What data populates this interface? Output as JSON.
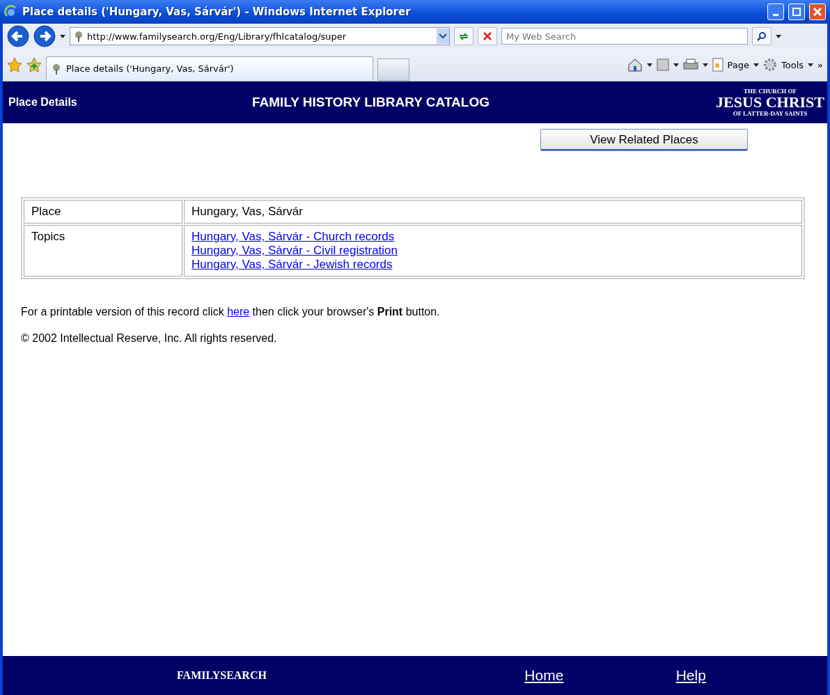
{
  "window": {
    "title": "Place details ('Hungary, Vas, Sárvár') - Windows Internet Explorer"
  },
  "address_bar": {
    "url": "http://www.familysearch.org/Eng/Library/fhlcatalog/super"
  },
  "search": {
    "placeholder": "My Web Search"
  },
  "tabs": [
    {
      "label": "Place details ('Hungary, Vas, Sárvár')",
      "selected": true
    }
  ],
  "command_bar": [
    {
      "label": "Page"
    },
    {
      "label": "Tools"
    }
  ],
  "overflow": "»",
  "banner": {
    "left": "Place Details",
    "center": "FAMILY HISTORY LIBRARY CATALOG",
    "logo_top": "THE CHURCH OF",
    "logo_main": "JESUS CHRIST",
    "logo_bottom": "OF LATTER-DAY SAINTS"
  },
  "related_button": "View Related Places",
  "details": [
    {
      "label": "Place",
      "kind": "text",
      "values": [
        "Hungary, Vas, Sárvár"
      ]
    },
    {
      "label": "Topics",
      "kind": "links",
      "values": [
        "Hungary, Vas, Sárvár - Church records",
        "Hungary, Vas, Sárvár - Civil registration",
        "Hungary, Vas, Sárvár - Jewish records"
      ]
    }
  ],
  "print_note": {
    "before": "For a printable version of this record click",
    "link": "here",
    "after": "then click your browser's **Print** button."
  },
  "copyright": "© 2002 Intellectual Reserve, Inc. All rights reserved.",
  "footer": {
    "logo": "FAMILYSEARCH",
    "links": [
      "Home",
      "Help"
    ]
  }
}
